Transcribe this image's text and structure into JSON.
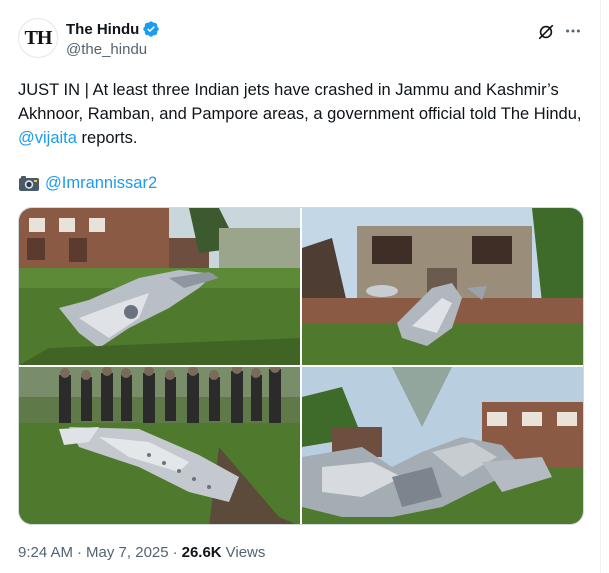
{
  "post": {
    "author": {
      "avatar_text": "TH",
      "display_name": "The Hindu",
      "handle": "@the_hindu",
      "verified_color": "#1d9bf0"
    },
    "text_main": "JUST IN | At least three Indian jets have crashed in Jammu and Kashmir’s Akhnoor, Ramban, and Pampore areas, a government official told The Hindu, ",
    "mention": "@vijaita",
    "text_after_mention": " reports.",
    "credit_icon": "camera-icon",
    "credit_handle": "@Imrannissar2",
    "media": [
      {
        "name": "wreckage-photo-1",
        "alt": ""
      },
      {
        "name": "wreckage-photo-2",
        "alt": ""
      },
      {
        "name": "wreckage-photo-3",
        "alt": ""
      },
      {
        "name": "wreckage-photo-4",
        "alt": ""
      }
    ],
    "time": "9:24 AM",
    "separator": "·",
    "date": "May 7, 2025",
    "views_count": "26.6K",
    "views_label": "Views"
  },
  "colors": {
    "link": "#1d9bf0",
    "secondary_text": "#536471",
    "primary_text": "#0f1419"
  }
}
